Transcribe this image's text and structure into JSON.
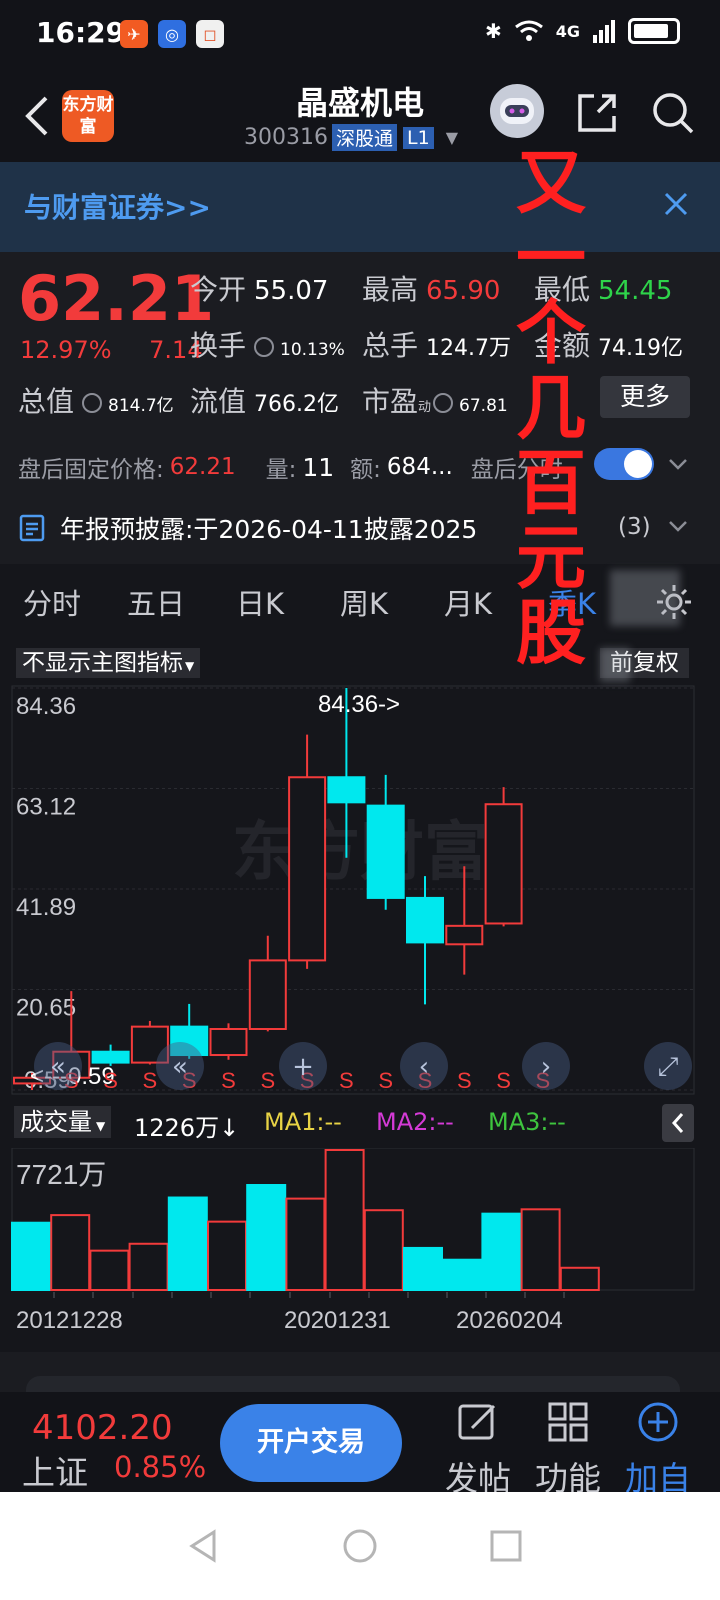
{
  "status_bar": {
    "time": "16:29",
    "network": "4G"
  },
  "header": {
    "logo_text": "东方财富",
    "stock_name": "晶盛机电",
    "stock_code": "300316",
    "tag_sgt": "深股通",
    "tag_level": "L1"
  },
  "banner": {
    "text": "与财富证券>>"
  },
  "quote": {
    "price": "62.21",
    "change_pct": "12.97%",
    "change_amt": "7.14",
    "open_label": "今开",
    "open": "55.07",
    "high_label": "最高",
    "high": "65.90",
    "low_label": "最低",
    "low": "54.45",
    "turnover_label": "换手",
    "turnover": "10.13%",
    "volume_label": "总手",
    "volume": "124.7万",
    "amount_label": "金额",
    "amount": "74.19亿",
    "mktcap_label": "总值",
    "mktcap": "814.7亿",
    "float_label": "流值",
    "float_cap": "766.2亿",
    "pe_label": "市盈",
    "pe_sup": "动",
    "pe": "67.81",
    "more_label": "更多"
  },
  "after_hours": {
    "price_label": "盘后固定价格:",
    "price": "62.21",
    "vol_label": "量:",
    "vol": "11",
    "amt_label": "额:",
    "amt": "684...",
    "timeshare_label": "盘后分时"
  },
  "report": {
    "text": "年报预披露:于2026-04-11披露2025",
    "count": "(3)"
  },
  "tabs": [
    "分时",
    "五日",
    "日K",
    "周K",
    "月K",
    "季K"
  ],
  "chart": {
    "indicator_label": "不显示主图指标",
    "fq_label": "前复权",
    "y_ticks": [
      "84.36",
      "63.12",
      "41.89",
      "20.65",
      "-0.59"
    ],
    "high_marker": "84.36->",
    "low_marker": "<---0.59",
    "s_marker": "S",
    "watermark": "东方财富"
  },
  "chart_data": {
    "type": "candlestick",
    "y_ticks": [
      84.36,
      63.12,
      41.89,
      20.65,
      -0.59
    ],
    "ylim": [
      -0.59,
      84.36
    ],
    "high_label": "84.36",
    "low_label": "-0.59",
    "x_tick_labels": [
      "20121228",
      "20201231",
      "20260204"
    ],
    "candles": [
      {
        "open": 0.8,
        "close": 2.0,
        "high": 3.0,
        "low": -0.59
      },
      {
        "open": 2.0,
        "close": 7.5,
        "high": 20.3,
        "low": 1.5
      },
      {
        "open": 7.5,
        "close": 5.2,
        "high": 9.0,
        "low": 4.5
      },
      {
        "open": 5.2,
        "close": 12.8,
        "high": 14.0,
        "low": 4.8
      },
      {
        "open": 12.8,
        "close": 6.8,
        "high": 17.6,
        "low": 6.0
      },
      {
        "open": 6.8,
        "close": 12.3,
        "high": 13.5,
        "low": 5.8
      },
      {
        "open": 12.3,
        "close": 26.8,
        "high": 32.0,
        "low": 11.8
      },
      {
        "open": 26.8,
        "close": 65.5,
        "high": 74.5,
        "low": 25.0
      },
      {
        "open": 65.5,
        "close": 60.2,
        "high": 84.36,
        "low": 48.5
      },
      {
        "open": 59.5,
        "close": 40.0,
        "high": 66.0,
        "low": 37.5
      },
      {
        "open": 40.0,
        "close": 30.6,
        "high": 44.6,
        "low": 17.5
      },
      {
        "open": 30.2,
        "close": 34.1,
        "high": 46.7,
        "low": 23.8
      },
      {
        "open": 34.6,
        "close": 59.8,
        "high": 63.4,
        "low": 34.0
      }
    ],
    "volume": {
      "label": "成交量",
      "current": "1226万↓",
      "max_label": "7721万",
      "ma": [
        "MA1:--",
        "MA2:--",
        "MA3:--"
      ],
      "bars": [
        {
          "value": 3710,
          "up": false
        },
        {
          "value": 4130,
          "up": true
        },
        {
          "value": 2170,
          "up": true
        },
        {
          "value": 2550,
          "up": true
        },
        {
          "value": 5100,
          "up": false
        },
        {
          "value": 3770,
          "up": true
        },
        {
          "value": 5790,
          "up": false
        },
        {
          "value": 5040,
          "up": true
        },
        {
          "value": 7721,
          "up": true
        },
        {
          "value": 4400,
          "up": true
        },
        {
          "value": 2320,
          "up": false
        },
        {
          "value": 1670,
          "up": false
        },
        {
          "value": 4210,
          "up": false
        },
        {
          "value": 4450,
          "up": true
        },
        {
          "value": 1226,
          "up": true
        }
      ]
    }
  },
  "bottom": {
    "index_value": "4102.20",
    "index_name": "上证",
    "index_change": "0.85%",
    "trade_label": "开户交易",
    "post_label": "发帖",
    "func_label": "功能",
    "add_label": "加自"
  },
  "overlay": {
    "text": "又一个几百元股"
  },
  "colors": {
    "up": "#f23b3b",
    "down": "#00e8ee",
    "accent": "#3a82e8"
  }
}
